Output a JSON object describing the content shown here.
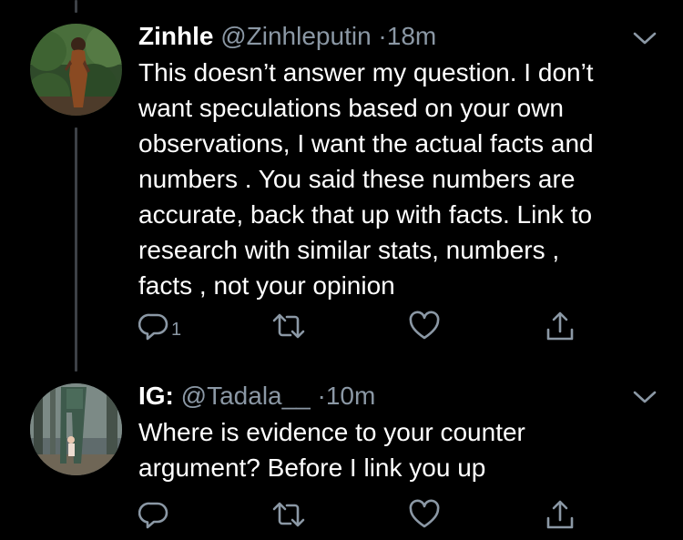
{
  "colors": {
    "background": "#000000",
    "text_primary": "#ffffff",
    "text_secondary": "#8b98a5",
    "thread_line": "#3d4146"
  },
  "tweets": [
    {
      "name": "Zinhle",
      "handle": "@Zinhleputin",
      "separator": "·",
      "time": "18m",
      "text_lines": [
        "This doesn’t answer my question. I don’t",
        "want speculations based on your own",
        "observations, I want the actual facts and",
        "numbers . You said these numbers are",
        "accurate, back that up with facts. Link to",
        "research with similar stats, numbers ,",
        "facts , not your opinion"
      ],
      "reply_count": "1",
      "icons": {
        "reply": "reply-icon",
        "retweet": "retweet-icon",
        "like": "heart-icon",
        "share": "share-icon",
        "more": "chevron-down-icon"
      }
    },
    {
      "name": "IG:",
      "handle": "@Tadala__",
      "separator": "·",
      "time": "10m",
      "text_lines": [
        "Where is evidence to your counter",
        "argument? Before I link you up"
      ],
      "reply_count": "",
      "icons": {
        "reply": "reply-icon",
        "retweet": "retweet-icon",
        "like": "heart-icon",
        "share": "share-icon",
        "more": "chevron-down-icon"
      }
    }
  ]
}
